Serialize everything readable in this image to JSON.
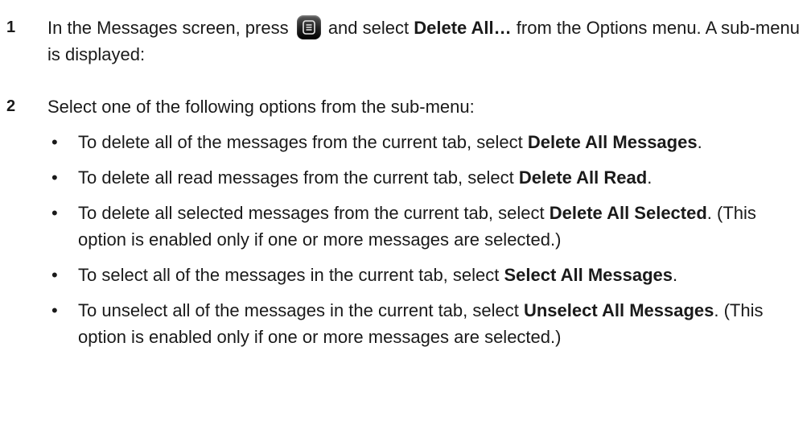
{
  "steps": [
    {
      "number": "1",
      "text_before_icon": "In the Messages screen, press ",
      "icon": "menu-key-icon",
      "text_after_icon": " and select ",
      "bold": "Delete All…",
      "text_end": " from the Options menu. A sub-menu is displayed:"
    },
    {
      "number": "2",
      "text": "Select one of the following options from the sub-menu:"
    }
  ],
  "bullets": [
    {
      "marker": "•",
      "text_before": "To delete all of the messages from the current tab, select ",
      "bold": "Delete All Messages",
      "text_after": "."
    },
    {
      "marker": "•",
      "text_before": "To delete all read messages from the current tab, select ",
      "bold": "Delete All Read",
      "text_after": "."
    },
    {
      "marker": "•",
      "text_before": "To delete all selected messages from the current tab, select ",
      "bold": "Delete All Selected",
      "text_after": ". (This option is enabled only if one or more messages are selected.)"
    },
    {
      "marker": "•",
      "text_before": "To select all of the messages in the current tab, select ",
      "bold": "Select All Messages",
      "text_after": "."
    },
    {
      "marker": "•",
      "text_before": "To unselect all of the messages in the current tab, select ",
      "bold": "Unselect All Messages",
      "text_after": ". (This option is enabled only if one or more messages are selected.)"
    }
  ]
}
